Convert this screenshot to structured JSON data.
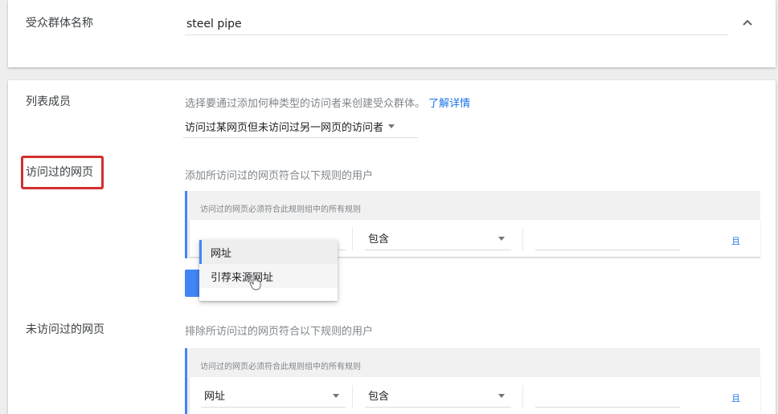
{
  "audience": {
    "name_label": "受众群体名称",
    "name_value": "steel pipe",
    "collapse_icon": "chevron-up-icon"
  },
  "members": {
    "label": "列表成员",
    "description": "选择要通过添加何种类型的访问者来创建受众群体。",
    "learn_more": "了解详情",
    "selected_type": "访问过某网页但未访问过另一网页的访问者"
  },
  "visited": {
    "label": "访问过的网页",
    "description": "添加所访问过的网页符合以下规则的用户",
    "panel_heading": "访问过的网页必须符合此规则组中的所有规则",
    "operator": "包含",
    "and_label": "且",
    "menu_options": [
      "网址",
      "引荐来源网址"
    ]
  },
  "not_visited": {
    "label": "未访问过的网页",
    "description": "排除所访问过的网页符合以下规则的用户",
    "panel_heading": "访问过的网页必须符合此规则组中的所有规则",
    "field": "网址",
    "operator": "包含",
    "and_label": "且"
  },
  "colors": {
    "accent": "#4285f4",
    "link": "#1a73e8",
    "highlight": "#d32f2f"
  }
}
